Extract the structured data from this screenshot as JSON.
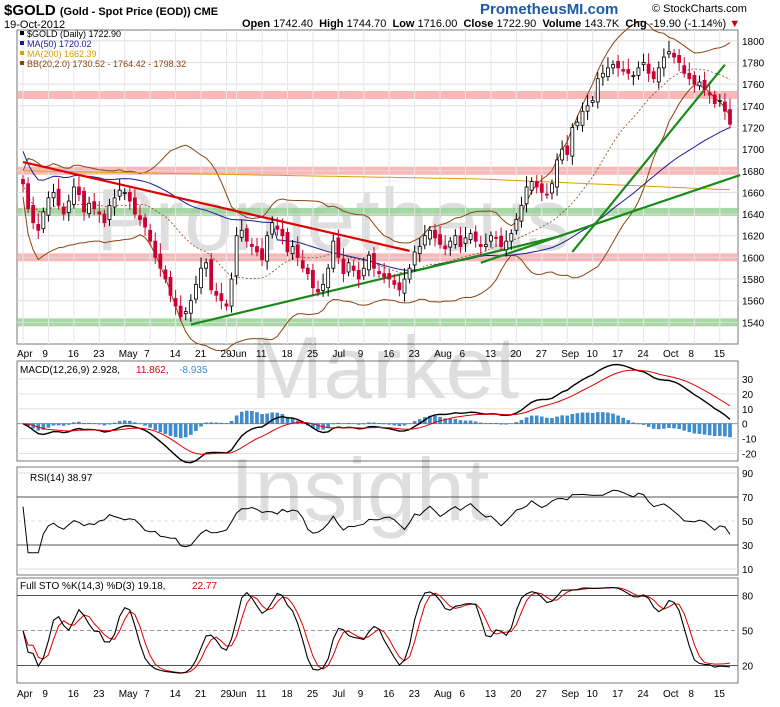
{
  "header": {
    "symbol": "$GOLD",
    "description": "(Gold - Spot Price (EOD)) CME",
    "date": "19-Oct-2012",
    "open_label": "Open",
    "open": "1742.40",
    "high_label": "High",
    "high": "1744.70",
    "low_label": "Low",
    "low": "1716.00",
    "close_label": "Close",
    "close": "1722.90",
    "volume_label": "Volume",
    "volume": "143.7K",
    "chg_label": "Chg",
    "chg": "-19.90 (-1.14%)",
    "brand": "PrometheusMI.com",
    "credit": "© StockCharts.com"
  },
  "watermark": [
    "Prometheus",
    "Market",
    "Insight"
  ],
  "colors": {
    "up": "#000000",
    "down": "#cc0033",
    "ma50": "#1a1a99",
    "ma200": "#d9a000",
    "bb": "#8b4513",
    "macd": "#000000",
    "signal": "#dd0000",
    "hist": "#3b8fd0",
    "resistance_band": "#f5a0a0",
    "support_band": "#90d090",
    "trend_red": "#e00000",
    "trend_green": "#1a8a1a"
  },
  "chart_data": [
    {
      "type": "candlestick",
      "legend": [
        {
          "label": "$GOLD (Daily) 1722.90",
          "color": "#000000"
        },
        {
          "label": "MA(50) 1720.02",
          "color": "#1a1a99"
        },
        {
          "label": "MA(200) 1662.39",
          "color": "#d9a000"
        },
        {
          "label": "BB(20,2.0) 1730.52 - 1764.42 - 1798.32",
          "color": "#8b4513"
        }
      ],
      "ylim": [
        1520,
        1810
      ],
      "yticks": [
        "1800",
        "1780",
        "1760",
        "1740",
        "1720",
        "1700",
        "1680",
        "1660",
        "1640",
        "1620",
        "1600",
        "1580",
        "1560",
        "1540"
      ],
      "xticks": [
        "Apr",
        "9",
        "16",
        "23",
        "May",
        "7",
        "14",
        "21",
        "29",
        "Jun",
        "11",
        "18",
        "25",
        "Jul",
        "9",
        "16",
        "23",
        "Aug",
        "6",
        "13",
        "20",
        "27",
        "Sep",
        "10",
        "17",
        "24",
        "Oct",
        "8",
        "15"
      ],
      "xtick_index": [
        0,
        5,
        10,
        15,
        20,
        25,
        30,
        35,
        40,
        42,
        47,
        52,
        57,
        62,
        67,
        72,
        77,
        82,
        87,
        92,
        97,
        102,
        107,
        112,
        117,
        122,
        127,
        132,
        137
      ],
      "close": [
        1668,
        1645,
        1632,
        1625,
        1642,
        1655,
        1660,
        1648,
        1640,
        1652,
        1665,
        1658,
        1642,
        1650,
        1645,
        1640,
        1632,
        1648,
        1655,
        1662,
        1660,
        1652,
        1640,
        1635,
        1628,
        1615,
        1600,
        1590,
        1580,
        1565,
        1555,
        1545,
        1550,
        1560,
        1575,
        1590,
        1595,
        1570,
        1565,
        1560,
        1555,
        1580,
        1620,
        1625,
        1615,
        1610,
        1605,
        1598,
        1620,
        1632,
        1626,
        1620,
        1605,
        1610,
        1600,
        1590,
        1585,
        1572,
        1568,
        1575,
        1590,
        1615,
        1600,
        1585,
        1595,
        1588,
        1580,
        1590,
        1602,
        1590,
        1585,
        1582,
        1580,
        1575,
        1570,
        1580,
        1590,
        1605,
        1610,
        1620,
        1625,
        1618,
        1612,
        1608,
        1615,
        1620,
        1610,
        1618,
        1622,
        1615,
        1610,
        1612,
        1620,
        1618,
        1610,
        1615,
        1622,
        1635,
        1648,
        1665,
        1670,
        1665,
        1660,
        1658,
        1668,
        1690,
        1700,
        1695,
        1720,
        1725,
        1735,
        1740,
        1745,
        1765,
        1770,
        1775,
        1778,
        1775,
        1772,
        1770,
        1768,
        1775,
        1780,
        1770,
        1765,
        1775,
        1785,
        1790,
        1785,
        1780,
        1770,
        1765,
        1760,
        1762,
        1755,
        1750,
        1742,
        1745,
        1735,
        1723
      ],
      "ma50_end": 1720.02,
      "ma200_end": 1662.39,
      "bb_end": [
        1730.52,
        1764.42,
        1798.32
      ],
      "resistance_bands": [
        1750,
        1680,
        1600
      ],
      "support_bands": [
        1642,
        1540
      ],
      "trendlines": [
        {
          "color": "red",
          "from": [
            0,
            1688
          ],
          "to": [
            76,
            1606
          ]
        },
        {
          "color": "green",
          "from": [
            33,
            1538
          ],
          "to": [
            106,
            1620
          ]
        },
        {
          "color": "green",
          "from": [
            90,
            1595
          ],
          "to": [
            160,
            1676
          ]
        },
        {
          "color": "green",
          "from": [
            108,
            1605
          ],
          "to": [
            138,
            1778
          ]
        }
      ]
    },
    {
      "type": "line",
      "legend": [
        {
          "label": "MACD(12,26,9) 2.928,",
          "color": "#000000"
        },
        {
          "label": "11.862,",
          "color": "#dd0000"
        },
        {
          "label": "-8.935",
          "color": "#3b8fd0"
        }
      ],
      "ylim": [
        -25,
        42
      ],
      "yticks": [
        "30",
        "20",
        "10",
        "0",
        "-10",
        "-20"
      ]
    },
    {
      "type": "line",
      "legend": [
        {
          "label": "RSI(14) 38.97",
          "color": "#000000"
        }
      ],
      "ylim": [
        5,
        95
      ],
      "yticks": [
        "90",
        "70",
        "50",
        "30",
        "10"
      ]
    },
    {
      "type": "line",
      "legend": [
        {
          "label": "Full STO %K(14,3) %D(3) 19.18,",
          "color": "#000000"
        },
        {
          "label": "22.77",
          "color": "#dd0000"
        }
      ],
      "ylim": [
        5,
        95
      ],
      "yticks": [
        "80",
        "50",
        "20"
      ]
    }
  ]
}
